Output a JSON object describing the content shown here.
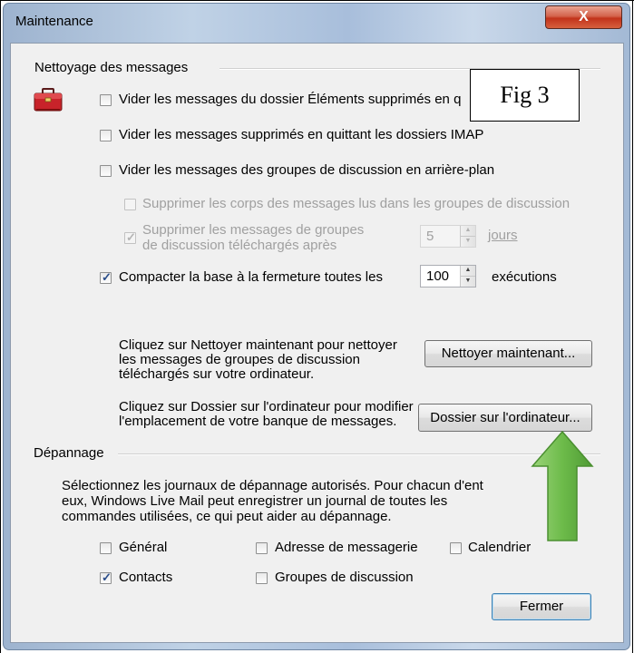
{
  "window": {
    "title": "Maintenance",
    "close_glyph": "X"
  },
  "cleanup": {
    "heading": "Nettoyage des messages",
    "icon": "toolbox-icon",
    "items": [
      {
        "label": "Vider les messages du dossier Éléments supprimés en q",
        "checked": false
      },
      {
        "label": "Vider les messages supprimés en quittant les dossiers IMAP",
        "checked": false
      },
      {
        "label": "Vider les messages des groupes de discussion en arrière-plan",
        "checked": false
      }
    ],
    "sub_bodies": {
      "label": "Supprimer les corps des messages lus dans les groupes de discussion",
      "checked": false
    },
    "sub_delete": {
      "label_line1": "Supprimer les messages de groupes",
      "label_line2": "de discussion téléchargés après",
      "checked": true,
      "value": "5",
      "unit": "jours"
    },
    "compact": {
      "label": "Compacter la base à la fermeture toutes les",
      "checked": true,
      "value": "100",
      "unit": "exécutions"
    }
  },
  "clean_now": {
    "desc_line1": "Cliquez sur Nettoyer maintenant pour nettoyer",
    "desc_line2": "les messages de groupes de discussion",
    "desc_line3": "téléchargés sur votre ordinateur.",
    "button": "Nettoyer maintenant..."
  },
  "store_folder": {
    "desc_line1": "Cliquez sur Dossier sur l'ordinateur pour modifier",
    "desc_line2": "l'emplacement de votre banque de messages.",
    "button": "Dossier sur l'ordinateur..."
  },
  "troubleshoot": {
    "heading": "Dépannage",
    "desc_line1": "Sélectionnez les journaux de dépannage autorisés. Pour chacun d'ent",
    "desc_line2": "eux, Windows Live Mail peut enregistrer un journal de toutes les",
    "desc_line3": "commandes utilisées, ce qui peut aider au dépannage.",
    "options": [
      {
        "label": "Général",
        "checked": false
      },
      {
        "label": "Adresse de messagerie",
        "checked": false
      },
      {
        "label": "Calendrier",
        "checked": false
      },
      {
        "label": "Contacts",
        "checked": true
      },
      {
        "label": "Groupes de discussion",
        "checked": false
      }
    ]
  },
  "close_button": "Fermer",
  "annotation": {
    "label": "Fig 3",
    "arrow_color": "#7cc35a"
  }
}
